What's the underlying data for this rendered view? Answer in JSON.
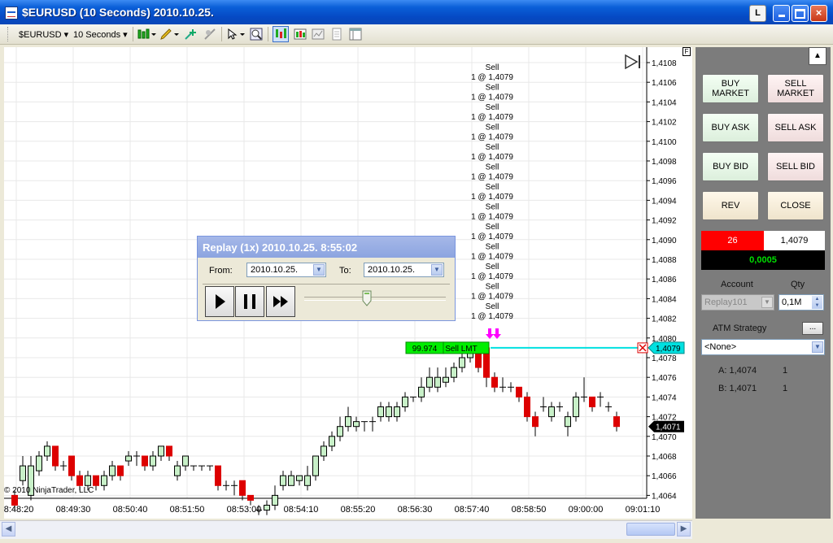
{
  "window": {
    "title": "$EURUSD (10 Seconds)  2010.10.25.",
    "l_button": "L",
    "minimize": "_",
    "maximize": "□",
    "close": "×"
  },
  "toolbar": {
    "instrument": "$EURUSD",
    "interval": "10 Seconds"
  },
  "chart": {
    "copyright": "© 2010 NinjaTrader, LLC",
    "price_labels": [
      "1,4108",
      "1,4106",
      "1,4104",
      "1,4102",
      "1,4100",
      "1,4098",
      "1,4096",
      "1,4094",
      "1,4092",
      "1,4090",
      "1,4088",
      "1,4086",
      "1,4084",
      "1,4082",
      "1,4080",
      "1,4078",
      "1,4076",
      "1,4074",
      "1,4072",
      "1,4070",
      "1,4068",
      "1,4066",
      "1,4064"
    ],
    "time_labels": [
      "08:48:20",
      "08:49:30",
      "08:50:40",
      "08:51:50",
      "08:53:00",
      "08:54:10",
      "08:55:20",
      "08:56:30",
      "08:57:40",
      "08:58:50",
      "09:00:00",
      "09:01:10"
    ],
    "trade_marker_top": "Sell",
    "trade_marker_bottom": "1 @ 1,4079",
    "order_qty": "99.974",
    "order_type": "Sell LMT",
    "order_price_tag": "1,4079",
    "last_price_tag": "1,4071",
    "f_box": "F"
  },
  "panel": {
    "buy_market": "BUY\nMARKET",
    "sell_market": "SELL\nMARKET",
    "buy_ask": "BUY ASK",
    "sell_ask": "SELL ASK",
    "buy_bid": "BUY BID",
    "sell_bid": "SELL BID",
    "rev": "REV",
    "close": "CLOSE",
    "position_qty": "26",
    "position_price": "1,4079",
    "pnl": "0,0005",
    "account_label": "Account",
    "qty_label": "Qty",
    "account_value": "Replay101",
    "qty_value": "0,1M",
    "atm_label": "ATM Strategy",
    "atm_button": "...",
    "atm_value": "<None>",
    "ask_line": "A: 1,4074",
    "ask_size": "1",
    "bid_line": "B: 1,4071",
    "bid_size": "1"
  },
  "replay": {
    "title": "Replay (1x) 2010.10.25. 8:55:02",
    "from_label": "From:",
    "from_value": "2010.10.25.",
    "to_label": "To:",
    "to_value": "2010.10.25."
  },
  "colors": {
    "up_candle": "#c8f0c8",
    "down_candle": "#dd0000",
    "order_line": "#00e0e0",
    "order_green": "#00ee00",
    "sell_arrow": "#ff00ff",
    "pnl_bg": "#000000",
    "pnl_text": "#00ff00",
    "position_bg": "#ff0000"
  }
}
